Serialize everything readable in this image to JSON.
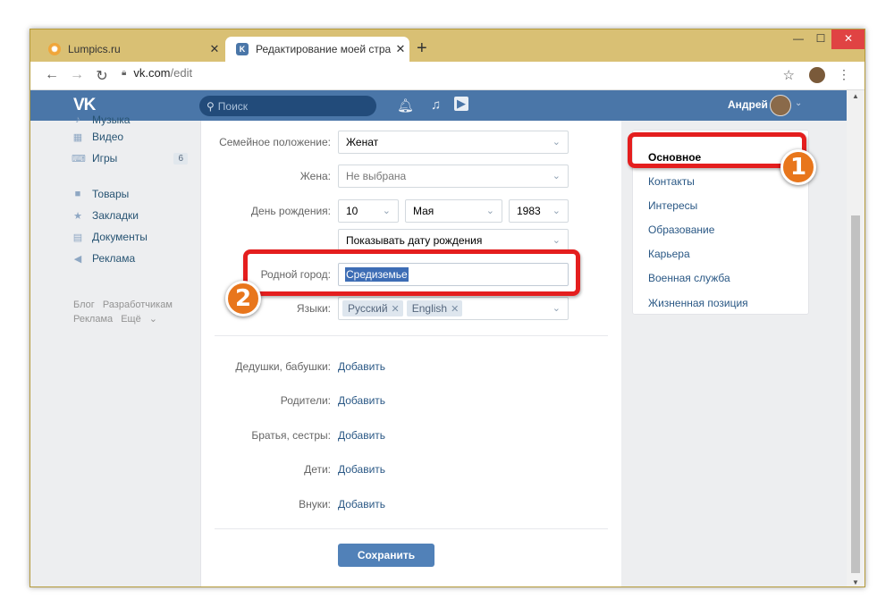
{
  "browser": {
    "tabs": [
      {
        "title": "Lumpics.ru",
        "favicon": "orange-favicon-icon"
      },
      {
        "title": "Редактирование моей страницы",
        "favicon": "vk-favicon-icon"
      }
    ],
    "address": {
      "host": "vk.com",
      "path": "/edit"
    }
  },
  "header": {
    "logo": "VK",
    "search_placeholder": "Поиск",
    "user_name": "Андрей"
  },
  "sidebar": {
    "items": [
      {
        "label": "Музыка",
        "icon": "music-icon"
      },
      {
        "label": "Видео",
        "icon": "film-icon"
      },
      {
        "label": "Игры",
        "icon": "gamepad-icon",
        "badge": "6"
      },
      {
        "label": "Товары",
        "icon": "bag-icon"
      },
      {
        "label": "Закладки",
        "icon": "star-icon"
      },
      {
        "label": "Документы",
        "icon": "document-icon"
      },
      {
        "label": "Реклама",
        "icon": "megaphone-icon"
      }
    ],
    "footer_links": [
      "Блог",
      "Разработчикам",
      "Реклама",
      "Ещё"
    ]
  },
  "form": {
    "marital_label": "Семейное положение:",
    "marital_value": "Женат",
    "spouse_label": "Жена:",
    "spouse_value": "Не выбрана",
    "birthday_label": "День рождения:",
    "birthday_day": "10",
    "birthday_month": "Мая",
    "birthday_year": "1983",
    "birthday_visibility": "Показывать дату рождения",
    "hometown_label": "Родной город:",
    "hometown_value": "Средиземье",
    "languages_label": "Языки:",
    "languages": [
      "Русский",
      "English"
    ],
    "relatives": [
      {
        "label": "Дедушки, бабушки:",
        "action": "Добавить"
      },
      {
        "label": "Родители:",
        "action": "Добавить"
      },
      {
        "label": "Братья, сестры:",
        "action": "Добавить"
      },
      {
        "label": "Дети:",
        "action": "Добавить"
      },
      {
        "label": "Внуки:",
        "action": "Добавить"
      }
    ],
    "save_label": "Сохранить"
  },
  "right_menu": {
    "items": [
      "Основное",
      "Контакты",
      "Интересы",
      "Образование",
      "Карьера",
      "Военная служба",
      "Жизненная позиция"
    ]
  },
  "annotations": {
    "step1": "1",
    "step2": "2"
  },
  "colors": {
    "vk_blue": "#4a76a8",
    "link": "#2a5885",
    "callout_red": "#e41e1e",
    "badge_orange": "#e8761c"
  }
}
